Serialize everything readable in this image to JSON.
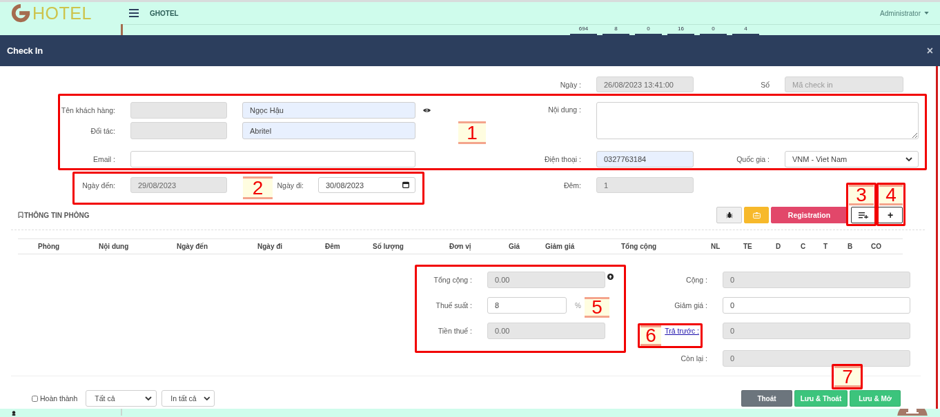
{
  "app_header": {
    "logo_text": "HOTEL",
    "site_title": "GHOTEL",
    "user_menu": "Administrator",
    "stats": [
      "694",
      "8",
      "0",
      "16",
      "0",
      "4"
    ]
  },
  "dialog": {
    "title": "Check In",
    "close": "×"
  },
  "form": {
    "date": {
      "label": "Ngày :",
      "value": "26/08/2023 13:41:00",
      "readonly": true
    },
    "number": {
      "label": "Số",
      "placeholder": "Mã check in",
      "readonly": true
    },
    "customer": {
      "label": "Tên khách hàng:",
      "code": {
        "readonly": true
      },
      "name": {
        "value": "Ngọc Hậu",
        "autofilled": true
      }
    },
    "content": {
      "label": "Nội dung :"
    },
    "partner": {
      "label": "Đối tác:",
      "code": {
        "readonly": true
      },
      "name": {
        "value": "Abritel",
        "autofilled": true
      }
    },
    "email": {
      "label": "Email :",
      "readonly": false
    },
    "phone": {
      "label": "Điện thoại :",
      "value": "0327763184",
      "autofilled": true
    },
    "country": {
      "label": "Quốc gia :",
      "value": "VNM - Viet Nam"
    },
    "arrival": {
      "label": "Ngày đến:",
      "value": "29/08/2023",
      "readonly": true
    },
    "departure": {
      "label": "Ngày đi:",
      "value": "30/08/2023",
      "readonly": false
    },
    "nights": {
      "label": "Đêm:",
      "value": "1",
      "readonly": true
    }
  },
  "rooms": {
    "title": "THÔNG TIN PHÒNG",
    "register_button": "Registration",
    "add_button": "+",
    "columns": [
      "Phòng",
      "Nội dung",
      "Ngày đến",
      "Ngày đi",
      "Đêm",
      "Số lượng",
      "Đơn vị",
      "Giá",
      "Giảm giá",
      "Tổng cộng",
      "NL",
      "TE",
      "D",
      "C",
      "T",
      "B",
      "CO"
    ]
  },
  "totals": {
    "left": [
      {
        "kind": "input",
        "label": "Tổng cộng :",
        "value": "0.00",
        "readonly": true
      },
      {
        "kind": "percent",
        "label": "Thuế suất :",
        "value": "8",
        "readonly": false,
        "suffix": "%"
      },
      {
        "kind": "input",
        "label": "Tiền thuế :",
        "value": "0.00",
        "readonly": true
      }
    ],
    "right": [
      {
        "kind": "input",
        "label": "Cộng :",
        "value": "0",
        "readonly": true
      },
      {
        "kind": "input",
        "label": "Giảm giá :",
        "value": "0",
        "readonly": false
      },
      {
        "kind": "link",
        "label": "Trả trước :",
        "value": "0",
        "readonly": true
      },
      {
        "kind": "input",
        "label": "Còn lại :",
        "value": "0",
        "readonly": true
      }
    ]
  },
  "footer": {
    "completed": {
      "label": "Hoàn thành",
      "checked": false
    },
    "filter": "Tất cả",
    "print": "In tất cả",
    "buttons": [
      {
        "label": "Thoát",
        "kind": "secondary"
      },
      {
        "label": "Lưu & Thoát",
        "kind": "success"
      },
      {
        "label": "Lưu & Mở",
        "kind": "success"
      }
    ]
  },
  "annotations": [
    "1",
    "2",
    "3",
    "4",
    "5",
    "6",
    "7"
  ]
}
